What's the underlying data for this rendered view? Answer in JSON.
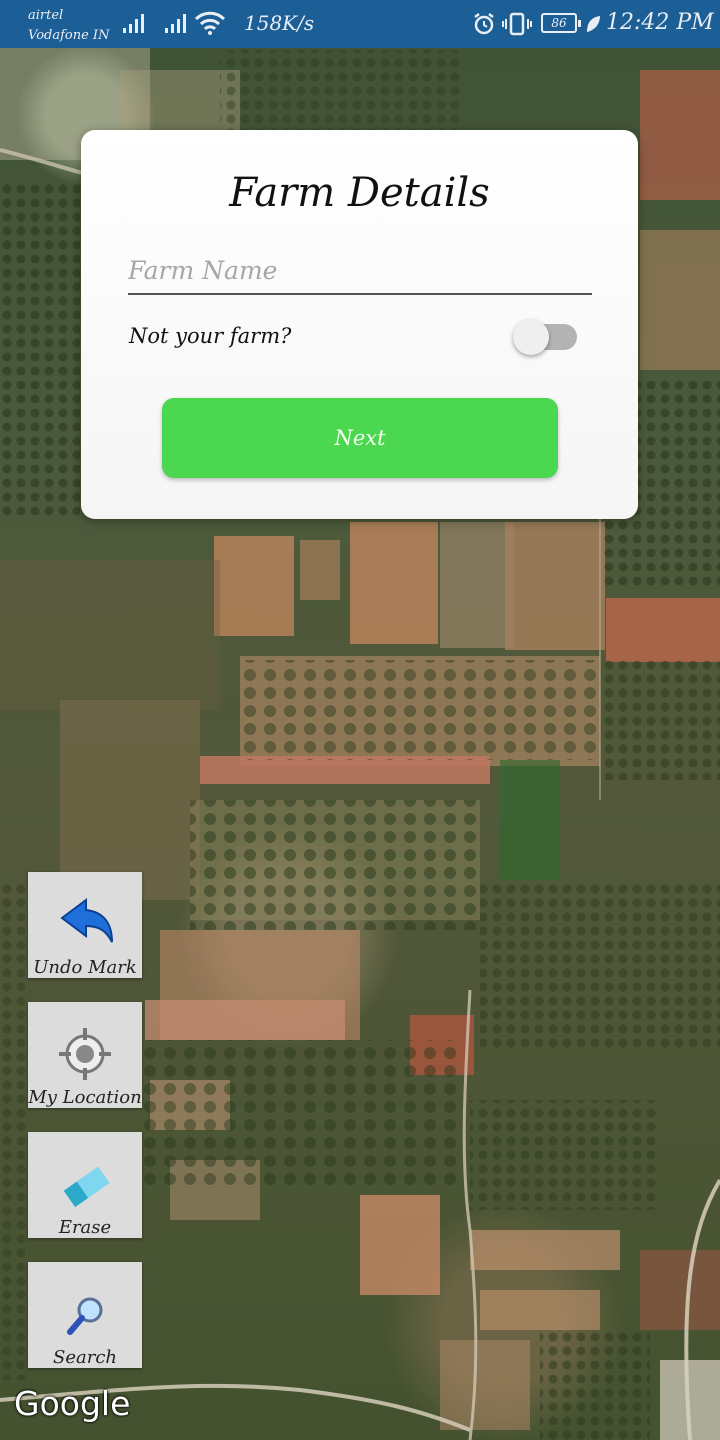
{
  "status_bar": {
    "carrier_primary": "airtel",
    "carrier_secondary": "Vodafone IN",
    "network_speed": "158K/s",
    "battery_level": "86",
    "time": "12:42 PM",
    "icons": [
      "signal-icon",
      "signal-icon",
      "wifi-icon",
      "alarm-icon",
      "vibrate-icon",
      "battery-icon",
      "leaf-icon"
    ]
  },
  "dialog": {
    "title": "Farm Details",
    "farm_name_placeholder": "Farm Name",
    "farm_name_value": "",
    "not_your_farm_label": "Not your farm?",
    "not_your_farm_toggle_on": false,
    "next_label": "Next"
  },
  "tools": {
    "undo_label": "Undo Mark",
    "my_location_label": "My Location",
    "erase_label": "Erase",
    "search_label": "Search"
  },
  "map": {
    "attribution": "Google",
    "map_type": "satellite"
  },
  "colors": {
    "status_bar": "#1c5f96",
    "next_button": "#4cd751",
    "tool_button": "#dcdcdc",
    "undo_icon": "#1e6fd9"
  }
}
